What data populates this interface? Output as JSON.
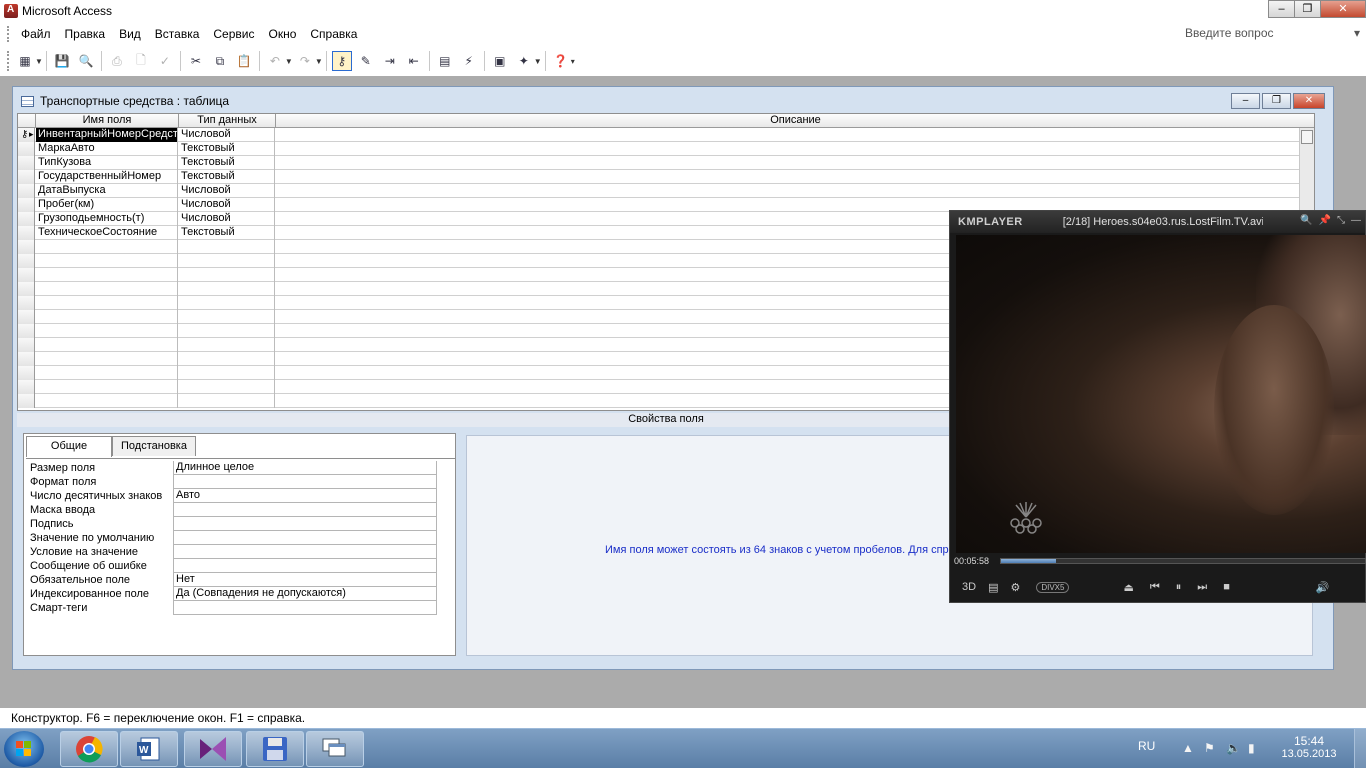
{
  "app": {
    "title": "Microsoft Access",
    "minimize": "–",
    "restore": "❐",
    "close": "✕"
  },
  "menu": {
    "items": [
      "Файл",
      "Правка",
      "Вид",
      "Вставка",
      "Сервис",
      "Окно",
      "Справка"
    ],
    "ask_placeholder": "Введите вопрос"
  },
  "table_window": {
    "title": "Транспортные средства : таблица",
    "columns": {
      "field_name": "Имя поля",
      "data_type": "Тип данных",
      "description": "Описание"
    },
    "rows": [
      {
        "name": "ИнвентарныйНомерСредства",
        "type": "Числовой"
      },
      {
        "name": "МаркаАвто",
        "type": "Текстовый"
      },
      {
        "name": "ТипКузова",
        "type": "Текстовый"
      },
      {
        "name": "ГосударственныйНомер",
        "type": "Текстовый"
      },
      {
        "name": "ДатаВыпуска",
        "type": "Числовой"
      },
      {
        "name": "Пробег(км)",
        "type": "Числовой"
      },
      {
        "name": "Грузоподьемность(т)",
        "type": "Числовой"
      },
      {
        "name": "ТехническоеСостояние",
        "type": "Текстовый"
      }
    ],
    "properties_caption": "Свойства поля",
    "tabs": [
      "Общие",
      "Подстановка"
    ],
    "properties": [
      {
        "label": "Размер поля",
        "value": "Длинное целое"
      },
      {
        "label": "Формат поля",
        "value": ""
      },
      {
        "label": "Число десятичных знаков",
        "value": "Авто"
      },
      {
        "label": "Маска ввода",
        "value": ""
      },
      {
        "label": "Подпись",
        "value": ""
      },
      {
        "label": "Значение по умолчанию",
        "value": ""
      },
      {
        "label": "Условие на значение",
        "value": ""
      },
      {
        "label": "Сообщение об ошибке",
        "value": ""
      },
      {
        "label": "Обязательное поле",
        "value": "Нет"
      },
      {
        "label": "Индексированное поле",
        "value": "Да (Совпадения не допускаются)"
      },
      {
        "label": "Смарт-теги",
        "value": ""
      }
    ],
    "hint": "Имя поля может состоять из 64 знаков с учетом пробелов.  Для спр"
  },
  "statusbar": {
    "text": "Конструктор.  F6 = переключение окон.  F1 = справка."
  },
  "player": {
    "brand": "KMPLAYER",
    "file_title": "[2/18] Heroes.s04e03.rus.LostFilm.TV.avi",
    "time": "00:05:58",
    "badge_3d": "3D",
    "codec": "DIVX5",
    "progress_fraction": 0.15
  },
  "taskbar": {
    "lang": "RU",
    "time": "15:44",
    "date": "13.05.2013"
  },
  "colors": {
    "hint_text": "#1a2ec8",
    "selection": "#000000",
    "taskbar": "#5a7ea6"
  }
}
